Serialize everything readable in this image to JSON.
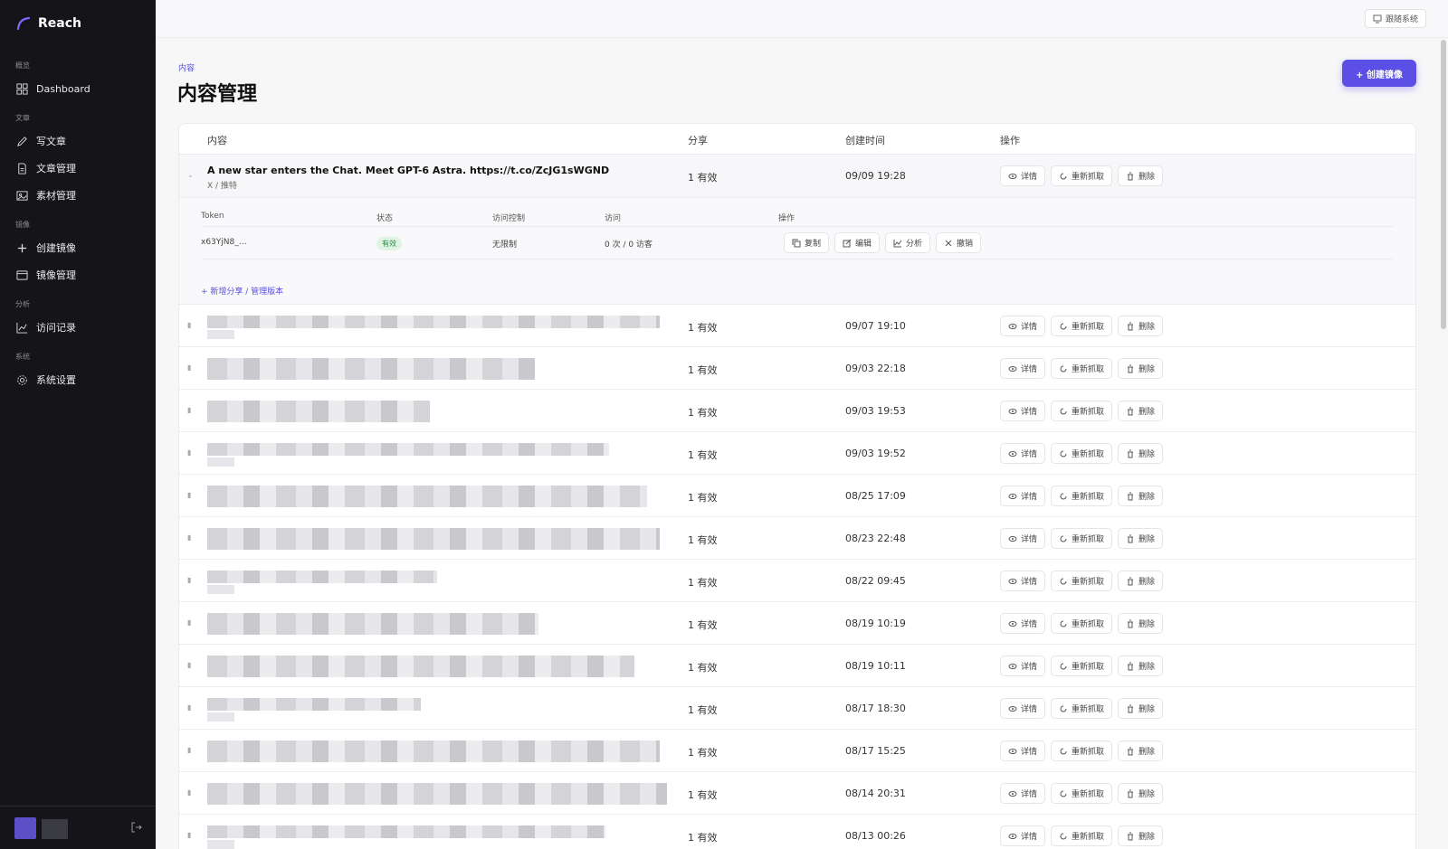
{
  "app": {
    "name": "Reach"
  },
  "sidebar": {
    "sections": [
      {
        "label": "概览",
        "items": [
          {
            "label": "Dashboard",
            "icon": "grid-icon"
          }
        ]
      },
      {
        "label": "文章",
        "items": [
          {
            "label": "写文章",
            "icon": "pen-icon"
          },
          {
            "label": "文章管理",
            "icon": "file-icon"
          },
          {
            "label": "素材管理",
            "icon": "image-icon"
          }
        ]
      },
      {
        "label": "镜像",
        "items": [
          {
            "label": "创建镜像",
            "icon": "plus-icon"
          },
          {
            "label": "镜像管理",
            "icon": "calendar-icon"
          }
        ]
      },
      {
        "label": "分析",
        "items": [
          {
            "label": "访问记录",
            "icon": "chart-icon"
          }
        ]
      },
      {
        "label": "系统",
        "items": [
          {
            "label": "系统设置",
            "icon": "gear-icon"
          }
        ]
      }
    ]
  },
  "topbar": {
    "follow_label": "跟随系统"
  },
  "header": {
    "breadcrumb": "内容",
    "title": "内容管理",
    "create_label": "+ 创建镜像"
  },
  "table": {
    "columns": [
      "内容",
      "分享",
      "创建时间",
      "操作"
    ],
    "actions": {
      "detail": "详情",
      "refetch": "重新抓取",
      "delete": "删除"
    },
    "expanded_row": {
      "title": "A new star enters the Chat. Meet GPT-6 Astra. https://t.co/ZcJG1sWGND",
      "source": "X / 推特",
      "share": "1 有效",
      "time": "09/09 19:28"
    },
    "share_panel": {
      "columns": [
        "Token",
        "状态",
        "访问控制",
        "访问",
        "操作"
      ],
      "token": "x63YjN8_…",
      "status": "有效",
      "access": "无限制",
      "visits": "0 次 / 0 访客",
      "ops": {
        "copy": "复制",
        "edit": "编辑",
        "analyze": "分析",
        "revoke": "撤销"
      },
      "add_label": "+ 新增分享 / 管理版本"
    },
    "rows": [
      {
        "share": "1 有效",
        "time": "09/07 19:10"
      },
      {
        "share": "1 有效",
        "time": "09/03 22:18"
      },
      {
        "share": "1 有效",
        "time": "09/03 19:53"
      },
      {
        "share": "1 有效",
        "time": "09/03 19:52"
      },
      {
        "share": "1 有效",
        "time": "08/25 17:09"
      },
      {
        "share": "1 有效",
        "time": "08/23 22:48"
      },
      {
        "share": "1 有效",
        "time": "08/22 09:45"
      },
      {
        "share": "1 有效",
        "time": "08/19 10:19"
      },
      {
        "share": "1 有效",
        "time": "08/19 10:11"
      },
      {
        "share": "1 有效",
        "time": "08/17 18:30"
      },
      {
        "share": "1 有效",
        "time": "08/17 15:25"
      },
      {
        "share": "1 有效",
        "time": "08/14 20:31"
      },
      {
        "share": "1 有效",
        "time": "08/13 00:26"
      }
    ]
  }
}
